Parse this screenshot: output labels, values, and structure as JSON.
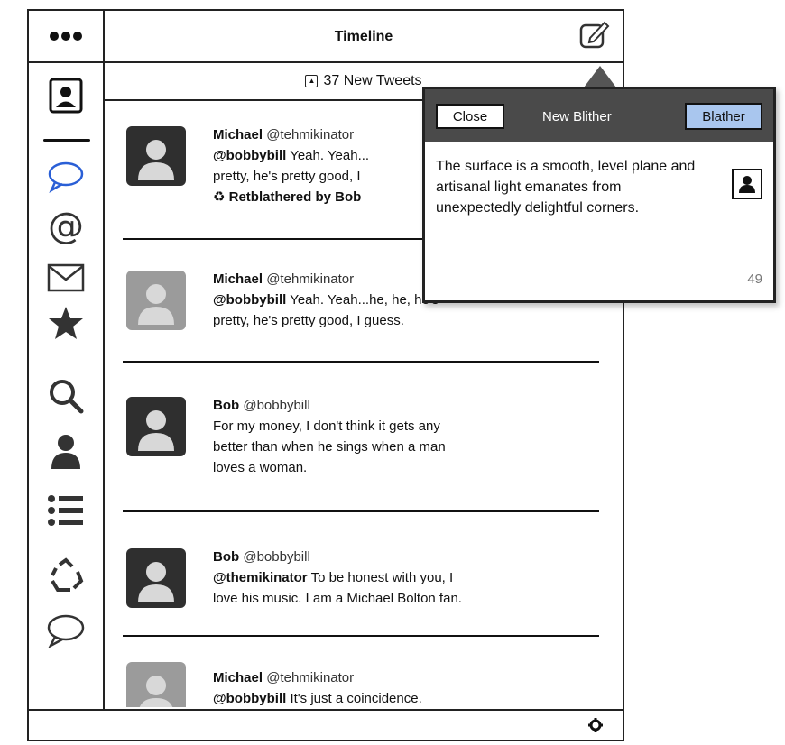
{
  "header": {
    "title": "Timeline"
  },
  "new_tweets": {
    "label": "37 New Tweets"
  },
  "tweets": [
    {
      "author": "Michael",
      "handle": "@tehmikinator",
      "line1_mention": "@bobbybill",
      "line1_text": "Yeah. Yeah...",
      "line2": "pretty, he's pretty good, I",
      "retweet": "Retblathered by Bob",
      "avatar_style": "dark"
    },
    {
      "author": "Michael",
      "handle": "@tehmikinator",
      "line1_mention": "@bobbybill",
      "line1_text": "Yeah. Yeah...he, he, he's",
      "line2": "pretty, he's pretty good, I guess.",
      "avatar_style": "light"
    },
    {
      "author": "Bob",
      "handle": "@bobbybill",
      "line1": "For my money, I don't think it gets any",
      "line2": "better than when he sings when a man",
      "line3": "loves a woman.",
      "avatar_style": "dark"
    },
    {
      "author": "Bob",
      "handle": "@bobbybill",
      "line1_mention": "@themikinator",
      "line1_text": "To be honest with you, I",
      "line2": "love his music. I am a Michael Bolton fan.",
      "avatar_style": "dark"
    },
    {
      "author": "Michael",
      "handle": "@tehmikinator",
      "line1_mention": "@bobbybill",
      "line1_text": "It's just a coincidence.",
      "avatar_style": "light"
    }
  ],
  "compose": {
    "close_label": "Close",
    "title": "New Blither",
    "submit_label": "Blather",
    "body": "The surface is a smooth, level plane and artisanal light emanates from unexpectedly delightful corners.",
    "char_count": "49"
  },
  "sidebar_icons": [
    "profile-icon",
    "speech-bubble-icon",
    "at-icon",
    "mail-icon",
    "star-icon",
    "search-icon",
    "user-icon",
    "list-icon",
    "recycle-icon",
    "comment-icon"
  ],
  "colors": {
    "accent_button": "#a9c6ee",
    "popover_header": "#4a4a4a"
  }
}
